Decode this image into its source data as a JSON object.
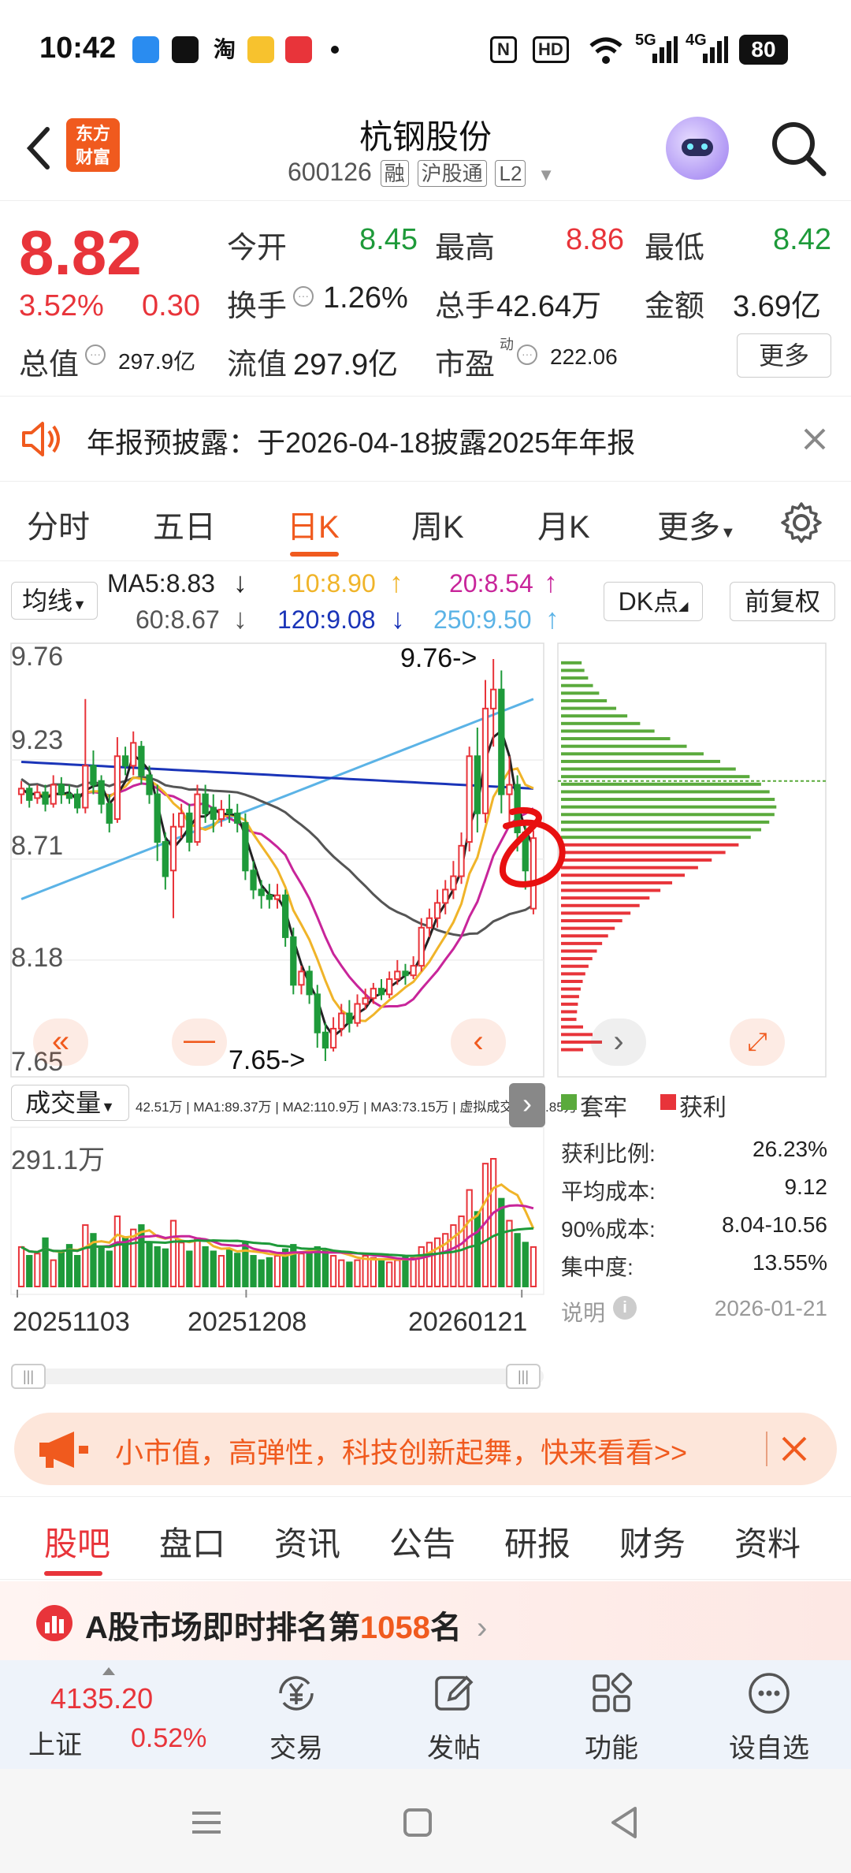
{
  "status_bar": {
    "time": "10:42",
    "hd": "HD",
    "net5g": "5G",
    "net4g": "4G",
    "battery": "80",
    "taobao_icon_text": "淘"
  },
  "header": {
    "logo_line1": "东方",
    "logo_line2": "财富",
    "title": "杭钢股份",
    "code": "600126",
    "tag_margin": "融",
    "tag_hk": "沪股通",
    "tag_level": "L2"
  },
  "quote": {
    "price": "8.82",
    "change_pct": "3.52%",
    "change_amt": "0.30",
    "open_label": "今开",
    "open": "8.45",
    "high_label": "最高",
    "high": "8.86",
    "low_label": "最低",
    "low": "8.42",
    "turnover_label": "换手",
    "turnover": "1.26%",
    "volume_label": "总手",
    "volume": "42.64万",
    "amount_label": "金额",
    "amount": "3.69亿",
    "mktcap_label": "总值",
    "mktcap": "297.9亿",
    "float_label": "流值",
    "float_cap": "297.9亿",
    "pe_label": "市盈",
    "pe_sup": "动",
    "pe": "222.06",
    "more_button": "更多"
  },
  "notice": {
    "text": "年报预披露：于2026-04-18披露2025年年报"
  },
  "kline_tabs": [
    {
      "label": "分时"
    },
    {
      "label": "五日"
    },
    {
      "label": "日K"
    },
    {
      "label": "周K"
    },
    {
      "label": "月K"
    },
    {
      "label": "更多"
    }
  ],
  "ma_legend": {
    "selector": "均线",
    "ma5": "MA5:8.83",
    "ma10": "10:8.90",
    "ma20": "20:8.54",
    "ma60": "60:8.67",
    "ma120": "120:9.08",
    "ma250": "250:9.50",
    "dk_button": "DK点",
    "adjust_button": "前复权"
  },
  "colors": {
    "up": "#e8343a",
    "down": "#1e9a3a",
    "ma5": "#222222",
    "ma10": "#f0b429",
    "ma20": "#c8259a",
    "ma60": "#555555",
    "ma120": "#1a34b8",
    "ma250": "#5bb3e6",
    "accent": "#f05a1e"
  },
  "chart_data": {
    "type": "candlestick",
    "y_ticks": [
      "9.76",
      "9.23",
      "8.71",
      "8.18",
      "7.65"
    ],
    "ylim": [
      7.65,
      9.76
    ],
    "high_marker": "9.76->",
    "low_marker": "7.65->",
    "x_ticks": [
      "20251103",
      "20251208",
      "20260121"
    ],
    "candles": [
      [
        9.05,
        9.08,
        9.12,
        9.0
      ],
      [
        9.08,
        9.02,
        9.1,
        8.98
      ],
      [
        9.03,
        9.06,
        9.1,
        9.0
      ],
      [
        9.06,
        9.0,
        9.1,
        8.96
      ],
      [
        9.0,
        9.1,
        9.15,
        8.98
      ],
      [
        9.1,
        9.05,
        9.14,
        9.0
      ],
      [
        9.05,
        9.03,
        9.1,
        9.0
      ],
      [
        9.05,
        8.98,
        9.08,
        8.95
      ],
      [
        8.98,
        9.2,
        9.55,
        8.95
      ],
      [
        9.2,
        9.1,
        9.28,
        9.05
      ],
      [
        9.12,
        9.0,
        9.15,
        8.95
      ],
      [
        9.0,
        8.9,
        9.05,
        8.85
      ],
      [
        8.92,
        9.25,
        9.35,
        8.9
      ],
      [
        9.25,
        9.2,
        9.3,
        9.15
      ],
      [
        9.2,
        9.32,
        9.38,
        9.15
      ],
      [
        9.3,
        9.15,
        9.33,
        9.1
      ],
      [
        9.15,
        9.05,
        9.2,
        9.0
      ],
      [
        9.05,
        8.8,
        9.1,
        8.7
      ],
      [
        8.8,
        8.62,
        8.85,
        8.55
      ],
      [
        8.65,
        8.88,
        8.95,
        8.4
      ],
      [
        8.88,
        8.95,
        9.0,
        8.82
      ],
      [
        8.95,
        8.8,
        9.0,
        8.75
      ],
      [
        8.8,
        9.05,
        9.1,
        8.78
      ],
      [
        9.05,
        8.95,
        9.1,
        8.9
      ],
      [
        8.98,
        8.92,
        9.05,
        8.85
      ],
      [
        8.92,
        8.97,
        9.02,
        8.88
      ],
      [
        8.97,
        8.95,
        9.05,
        8.9
      ],
      [
        8.95,
        8.9,
        9.0,
        8.85
      ],
      [
        8.9,
        8.65,
        8.95,
        8.6
      ],
      [
        8.65,
        8.55,
        8.7,
        8.5
      ],
      [
        8.55,
        8.52,
        8.6,
        8.45
      ],
      [
        8.52,
        8.5,
        8.58,
        8.45
      ],
      [
        8.5,
        8.52,
        8.58,
        8.45
      ],
      [
        8.52,
        8.3,
        8.55,
        8.25
      ],
      [
        8.3,
        8.05,
        8.35,
        8.0
      ],
      [
        8.05,
        8.12,
        8.15,
        8.0
      ],
      [
        8.12,
        8.0,
        8.15,
        7.95
      ],
      [
        8.0,
        7.8,
        8.05,
        7.72
      ],
      [
        7.8,
        7.72,
        7.85,
        7.65
      ],
      [
        7.72,
        7.82,
        7.88,
        7.7
      ],
      [
        7.82,
        7.9,
        7.95,
        7.78
      ],
      [
        7.9,
        7.85,
        7.97,
        7.8
      ],
      [
        7.85,
        7.95,
        8.0,
        7.83
      ],
      [
        7.95,
        7.98,
        8.03,
        7.92
      ],
      [
        7.98,
        8.03,
        8.06,
        7.95
      ],
      [
        8.03,
        8.0,
        8.08,
        7.97
      ],
      [
        8.0,
        8.08,
        8.12,
        7.98
      ],
      [
        8.08,
        8.12,
        8.18,
        8.05
      ],
      [
        8.12,
        8.1,
        8.16,
        8.05
      ],
      [
        8.1,
        8.15,
        8.2,
        8.08
      ],
      [
        8.15,
        8.35,
        8.4,
        8.12
      ],
      [
        8.35,
        8.4,
        8.45,
        8.3
      ],
      [
        8.4,
        8.48,
        8.55,
        8.35
      ],
      [
        8.48,
        8.55,
        8.6,
        8.42
      ],
      [
        8.55,
        8.62,
        8.7,
        8.5
      ],
      [
        8.62,
        8.78,
        8.85,
        8.58
      ],
      [
        8.8,
        9.25,
        9.3,
        8.75
      ],
      [
        9.25,
        8.95,
        9.4,
        8.85
      ],
      [
        8.95,
        9.5,
        9.65,
        8.9
      ],
      [
        9.5,
        9.6,
        9.76,
        9.3
      ],
      [
        9.6,
        9.05,
        9.7,
        8.95
      ],
      [
        9.05,
        9.1,
        9.25,
        8.9
      ],
      [
        9.1,
        8.85,
        9.15,
        8.75
      ],
      [
        8.85,
        8.65,
        8.9,
        8.55
      ],
      [
        8.45,
        8.82,
        8.86,
        8.42
      ]
    ],
    "volume": {
      "selector": "成交量",
      "legend": "42.51万 | MA1:89.37万 | MA2:110.9万 | MA3:73.15万 | 虚拟成交量:64.85万",
      "max_label": "291.1万",
      "values": [
        90,
        70,
        75,
        110,
        60,
        80,
        95,
        70,
        140,
        120,
        90,
        80,
        160,
        110,
        130,
        140,
        100,
        90,
        85,
        150,
        100,
        80,
        110,
        90,
        80,
        70,
        85,
        75,
        100,
        70,
        60,
        65,
        70,
        85,
        95,
        75,
        80,
        90,
        85,
        70,
        60,
        55,
        60,
        70,
        65,
        60,
        55,
        60,
        70,
        65,
        90,
        100,
        110,
        120,
        140,
        160,
        220,
        170,
        280,
        291,
        200,
        150,
        120,
        100,
        90
      ]
    },
    "chip": {
      "legend_trapped": "套牢",
      "legend_profit": "获利",
      "profit_ratio_label": "获利比例:",
      "profit_ratio": "26.23%",
      "avg_cost_label": "平均成本:",
      "avg_cost": "9.12",
      "cost90_label": "90%成本:",
      "cost90": "8.04-10.56",
      "concentration_label": "集中度:",
      "concentration": "13.55%",
      "note_label": "说明",
      "date": "2026-01-21"
    }
  },
  "ad": {
    "text": "小市值，高弹性，科技创新起舞，快来看看>>"
  },
  "bottom_tabs": [
    {
      "label": "股吧"
    },
    {
      "label": "盘口"
    },
    {
      "label": "资讯"
    },
    {
      "label": "公告"
    },
    {
      "label": "研报"
    },
    {
      "label": "财务"
    },
    {
      "label": "资料"
    }
  ],
  "rank": {
    "prefix": "A股市场即时排名第",
    "number": "1058",
    "suffix": "名"
  },
  "toolbar": {
    "index_value": "4135.20",
    "index_name": "上证",
    "index_pct": "0.52%",
    "trade": "交易",
    "post": "发帖",
    "functions": "功能",
    "watchlist": "设自选"
  }
}
